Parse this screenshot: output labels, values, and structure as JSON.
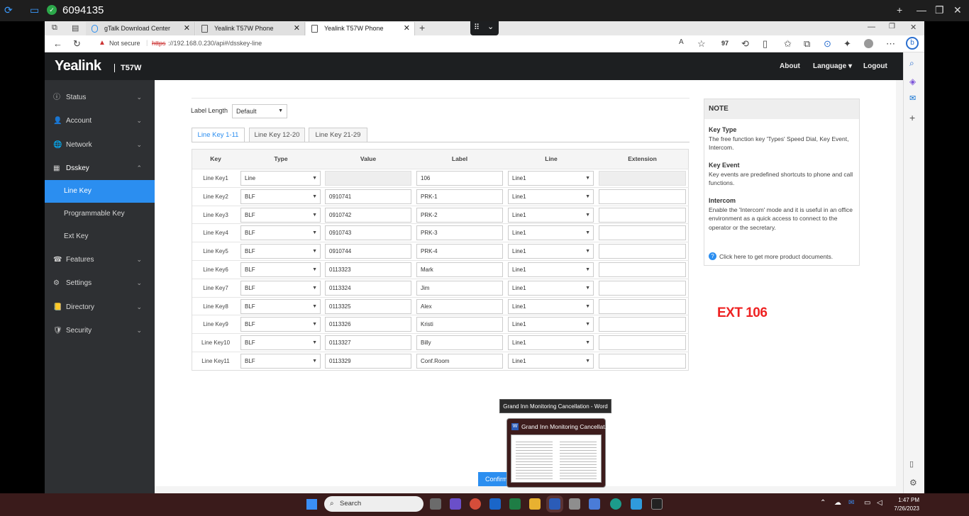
{
  "remote": {
    "id": "6094135"
  },
  "browser": {
    "tabs": [
      {
        "label": "gTalk Download Center"
      },
      {
        "label": "Yealink T57W Phone"
      },
      {
        "label": "Yealink T57W Phone"
      }
    ],
    "security": "Not secure",
    "url_scheme": "https",
    "url_rest": "://192.168.0.230/api#/dsskey-line",
    "badge": "97"
  },
  "header": {
    "logo": "Yealink",
    "model": "T57W",
    "about": "About",
    "language": "Language ▾",
    "logout": "Logout"
  },
  "nav": {
    "items": [
      {
        "label": "Status",
        "icon": "ⓘ"
      },
      {
        "label": "Account",
        "icon": "👤"
      },
      {
        "label": "Network",
        "icon": "🌐"
      },
      {
        "label": "Dsskey",
        "icon": "▦"
      },
      {
        "label": "Features",
        "icon": "☎"
      },
      {
        "label": "Settings",
        "icon": "⚙"
      },
      {
        "label": "Directory",
        "icon": "📒"
      },
      {
        "label": "Security",
        "icon": "🛡"
      }
    ],
    "sub": [
      {
        "label": "Line Key"
      },
      {
        "label": "Programmable Key"
      },
      {
        "label": "Ext Key"
      }
    ]
  },
  "settings": {
    "label_length_label": "Label Length",
    "label_length_value": "Default",
    "tabs": [
      "Line Key 1-11",
      "Line Key 12-20",
      "Line Key 21-29"
    ],
    "columns": [
      "Key",
      "Type",
      "Value",
      "Label",
      "Line",
      "Extension"
    ],
    "rows": [
      {
        "key": "Line Key1",
        "type": "Line",
        "value": "",
        "label": "106",
        "line": "Line1"
      },
      {
        "key": "Line Key2",
        "type": "BLF",
        "value": "0910741",
        "label": "PRK-1",
        "line": "Line1"
      },
      {
        "key": "Line Key3",
        "type": "BLF",
        "value": "0910742",
        "label": "PRK-2",
        "line": "Line1"
      },
      {
        "key": "Line Key4",
        "type": "BLF",
        "value": "0910743",
        "label": "PRK-3",
        "line": "Line1"
      },
      {
        "key": "Line Key5",
        "type": "BLF",
        "value": "0910744",
        "label": "PRK-4",
        "line": "Line1"
      },
      {
        "key": "Line Key6",
        "type": "BLF",
        "value": "0113323",
        "label": "Mark",
        "line": "Line1"
      },
      {
        "key": "Line Key7",
        "type": "BLF",
        "value": "0113324",
        "label": "Jim",
        "line": "Line1"
      },
      {
        "key": "Line Key8",
        "type": "BLF",
        "value": "0113325",
        "label": "Alex",
        "line": "Line1"
      },
      {
        "key": "Line Key9",
        "type": "BLF",
        "value": "0113326",
        "label": "Kristi",
        "line": "Line1"
      },
      {
        "key": "Line Key10",
        "type": "BLF",
        "value": "0113327",
        "label": "Billy",
        "line": "Line1"
      },
      {
        "key": "Line Key11",
        "type": "BLF",
        "value": "0113329",
        "label": "Conf.Room",
        "line": "Line1"
      }
    ],
    "confirm": "Confirm"
  },
  "note": {
    "title": "NOTE",
    "key_type_title": "Key Type",
    "key_type_text": "The free function key 'Types' Speed Dial, Key Event, Intercom.",
    "key_event_title": "Key Event",
    "key_event_text": "Key events are predefined shortcuts to phone and call functions.",
    "intercom_title": "Intercom",
    "intercom_text": "Enable the 'Intercom' mode and it is useful in an office environment as a quick access to connect to the operator or the secretary.",
    "docs_link": "Click here to get more product documents."
  },
  "overlay": {
    "ext_label": "EXT 106"
  },
  "taskbar": {
    "search": "Search",
    "tooltip": "Grand Inn Monitoring Cancellation - Word",
    "preview_title": "Grand Inn Monitoring Cancellat...",
    "time": "1:47 PM",
    "date": "7/26/2023"
  }
}
